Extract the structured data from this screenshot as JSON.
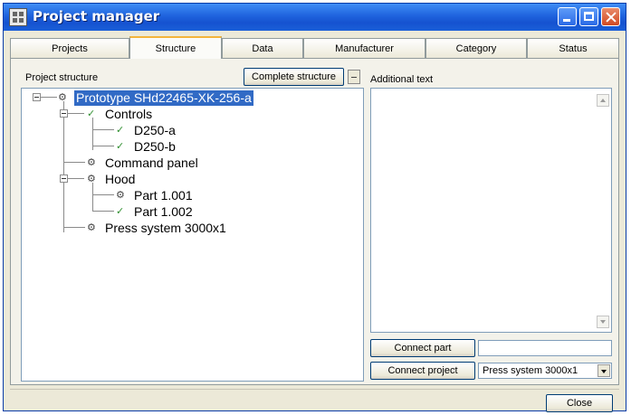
{
  "window": {
    "title": "Project manager"
  },
  "tabs": [
    {
      "label": "Projects"
    },
    {
      "label": "Structure"
    },
    {
      "label": "Data"
    },
    {
      "label": "Manufacturer"
    },
    {
      "label": "Category"
    },
    {
      "label": "Status"
    }
  ],
  "structure": {
    "heading": "Project structure",
    "complete_button": "Complete structure",
    "tree": [
      {
        "label": "Prototype SHd22465-XK-256-a",
        "icon": "assembly-icon",
        "selected": true
      },
      {
        "label": "Controls",
        "icon": "check-icon"
      },
      {
        "label": "D250-a",
        "icon": "check-icon"
      },
      {
        "label": "D250-b",
        "icon": "check-icon"
      },
      {
        "label": "Command panel",
        "icon": "gear-icon"
      },
      {
        "label": "Hood",
        "icon": "gear-icon"
      },
      {
        "label": "Part 1.001",
        "icon": "gear-icon"
      },
      {
        "label": "Part 1.002",
        "icon": "check-icon"
      },
      {
        "label": "Press system 3000x1",
        "icon": "assembly-icon"
      }
    ]
  },
  "additional": {
    "heading": "Additional text",
    "text": ""
  },
  "connect": {
    "part_button": "Connect part",
    "part_value": "",
    "project_button": "Connect project",
    "project_value": "Press system 3000x1"
  },
  "footer": {
    "close_button": "Close"
  },
  "colors": {
    "selection": "#316ac5",
    "titlebar": "#1f63de",
    "tab_highlight": "#f3b43c"
  }
}
